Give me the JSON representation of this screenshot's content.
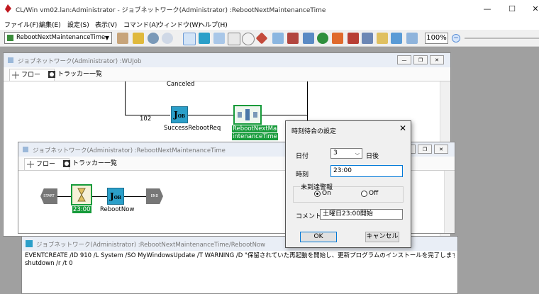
{
  "app": {
    "title": "CL/Win vm02.lan:Administrator - ジョブネットワーク(Administrator) :RebootNextMaintenanceTime",
    "controls": {
      "minimize": "—",
      "maximize": "☐",
      "close": "✕"
    }
  },
  "menu": [
    "ファイル(F)",
    "編集(E)",
    "設定(S)",
    "表示(V)",
    "コマンド(A)",
    "ウィンドウ(W)",
    "ヘルプ(H)"
  ],
  "toolbar": {
    "job_select": "RebootNextMaintenanceTime",
    "zoom": "100%",
    "zoom_minus": "−"
  },
  "win_wujob": {
    "title": "ジョブネットワーク(Administrator) :WUJob",
    "tabs": [
      "フロー",
      "トラッカー一覧"
    ],
    "status_text": "Canceled",
    "edge_label": "102",
    "nodes": {
      "success": "SuccessRebootReq",
      "reboot_line1": "RebootNextMa",
      "reboot_line2": "intenanceTime"
    }
  },
  "win_reboot": {
    "title": "ジョブネットワーク(Administrator) :RebootNextMaintenanceTime",
    "tabs": [
      "フロー",
      "トラッカー一覧"
    ],
    "nodes": {
      "start": "START",
      "timer": "23:00",
      "job": "RebootNow",
      "end": "END"
    }
  },
  "win_script": {
    "title": "ジョブネットワーク(Administrator) :RebootNextMaintenanceTime/RebootNow",
    "lines": [
      "EVENTCREATE /ID 910 /L System /SO MyWindowsUpdate /T WARNING /D \"保留されていた再起動を開始し、更新プログラムのインストールを完了します。\"",
      "shutdown /r /t 0"
    ]
  },
  "dialog": {
    "title": "時刻待合の設定",
    "close": "✕",
    "date_label": "日付",
    "date_value": "3",
    "date_suffix": "日後",
    "time_label": "時刻",
    "time_value": "23:00",
    "alarm_group": "未到達警報",
    "alarm_on": "On",
    "alarm_off": "Off",
    "comment_label": "コメント",
    "comment_value": "土曜日23:00開始",
    "ok": "OK",
    "cancel": "キャンセル"
  },
  "colors": {
    "selection_green": "#169b3a",
    "job_blue": "#2b9fc9"
  }
}
